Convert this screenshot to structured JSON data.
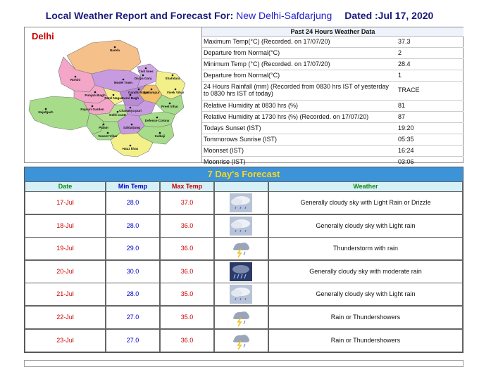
{
  "header": {
    "title_prefix": "Local Weather Report and Forecast For:",
    "station": "New Delhi-Safdarjung",
    "dated": "Dated :Jul 17, 2020"
  },
  "map": {
    "title": "Delhi",
    "labels": [
      "Narela",
      "Rohini",
      "Model Town",
      "Shahdara",
      "Civil lines",
      "Seelampur",
      "Punjabi Bagh",
      "Patel Nagar",
      "Karol Bagh",
      "Rajouri Garden",
      "Preet Vihar",
      "Gandhi Nagar",
      "Delhi cantt",
      "Chanakya puri",
      "Najafgarh",
      "Palam",
      "Defence Colony",
      "Vasant Vihar",
      "Safdarjung",
      "Kalkaji",
      "Hauz khas",
      "Darya Ganj",
      "Vivek Vihar"
    ]
  },
  "stats": {
    "header": "Past 24 Hours Weather Data",
    "rows": [
      {
        "label": "Maximum Temp(°C) (Recorded. on 17/07/20)",
        "value": "37.3"
      },
      {
        "label": "Departure from Normal(°C)",
        "value": "2"
      },
      {
        "label": "Minimum Temp (°C) (Recorded. on 17/07/20)",
        "value": "28.4"
      },
      {
        "label": "Departure from Normal(°C)",
        "value": "1"
      },
      {
        "label": "24 Hours Rainfall (mm) (Recorded from 0830 hrs IST of yesterday to 0830 hrs IST of today)",
        "value": "TRACE"
      },
      {
        "label": "Relative Humidity at 0830 hrs (%)",
        "value": "81"
      },
      {
        "label": "Relative Humidity at 1730 hrs (%) (Recorded. on 17/07/20)",
        "value": "87"
      },
      {
        "label": "Todays Sunset (IST)",
        "value": "19:20"
      },
      {
        "label": "Tommorows Sunrise (IST)",
        "value": "05:35"
      },
      {
        "label": "Moonset (IST)",
        "value": "16:24"
      },
      {
        "label": "Moonrise (IST)",
        "value": "03:06"
      }
    ]
  },
  "forecast": {
    "title": "7 Day's Forecast",
    "columns": {
      "date": "Date",
      "min": "Min Temp",
      "max": "Max Temp",
      "weather": "Weather"
    },
    "rows": [
      {
        "date": "17-Jul",
        "min": "28.0",
        "max": "37.0",
        "icon": "cloudy-light-rain-icon",
        "weather": "Generally cloudy sky with Light Rain or Drizzle"
      },
      {
        "date": "18-Jul",
        "min": "28.0",
        "max": "36.0",
        "icon": "cloudy-light-rain-icon",
        "weather": "Generally cloudy sky with Light rain"
      },
      {
        "date": "19-Jul",
        "min": "29.0",
        "max": "36.0",
        "icon": "thunderstorm-icon",
        "weather": "Thunderstorm with rain"
      },
      {
        "date": "20-Jul",
        "min": "30.0",
        "max": "36.0",
        "icon": "moderate-rain-icon",
        "weather": "Generally cloudy sky with moderate rain"
      },
      {
        "date": "21-Jul",
        "min": "28.0",
        "max": "35.0",
        "icon": "cloudy-light-rain-icon",
        "weather": "Generally cloudy sky with Light rain"
      },
      {
        "date": "22-Jul",
        "min": "27.0",
        "max": "35.0",
        "icon": "thunderstorm-icon",
        "weather": "Rain or Thundershowers"
      },
      {
        "date": "23-Jul",
        "min": "27.0",
        "max": "36.0",
        "icon": "thunderstorm-icon",
        "weather": "Rain or Thundershowers"
      }
    ]
  }
}
